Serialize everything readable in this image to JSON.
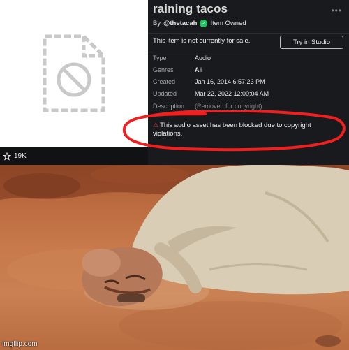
{
  "item": {
    "title": "raining tacos",
    "more_label": "•••",
    "by_prefix": "By",
    "creator": "@thetacah",
    "owned_label": "Item Owned",
    "sale_status": "This item is not currently for sale.",
    "studio_button": "Try in Studio",
    "favorites": "19K"
  },
  "details": [
    {
      "key": "Type",
      "value": "Audio"
    },
    {
      "key": "Genres",
      "value": "All"
    },
    {
      "key": "Created",
      "value": "Jan 16, 2014 6:57:23 PM"
    },
    {
      "key": "Updated",
      "value": "Mar 22, 2022 12:00:04 AM"
    },
    {
      "key": "Description",
      "value": "(Removed for copyright)"
    }
  ],
  "notice": {
    "icon": "warning-icon",
    "text": "This audio asset has been blocked due to copyright violations."
  },
  "watermark": "imgflip.com",
  "colors": {
    "panel_bg": "#191a1d",
    "verified_green": "#1ec45c",
    "warning_red": "#e84a3a",
    "annotation_red": "#ee2020"
  }
}
